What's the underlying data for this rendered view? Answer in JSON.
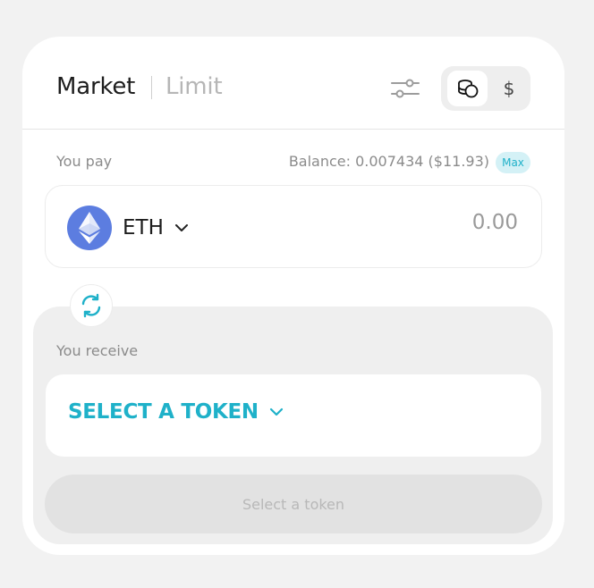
{
  "tabs": {
    "market": "Market",
    "limit": "Limit",
    "active": "market"
  },
  "currency_toggle": {
    "coin_icon": "coins-icon",
    "usd_label": "$",
    "active": "coin"
  },
  "pay": {
    "label": "You pay",
    "balance": "Balance: 0.007434 ($11.93)",
    "max_label": "Max",
    "token_symbol": "ETH",
    "token_icon": "ethereum-icon",
    "amount_placeholder": "0.00"
  },
  "receive": {
    "label": "You receive",
    "select_token_label": "SELECT A TOKEN"
  },
  "action_button": {
    "label": "Select a token",
    "enabled": false
  },
  "colors": {
    "accent": "#1fb1c9",
    "eth_blue": "#5c7de0",
    "max_badge_bg": "#d4f1f6",
    "page_bg": "#f2f2f2",
    "panel_bg": "#efefef"
  }
}
